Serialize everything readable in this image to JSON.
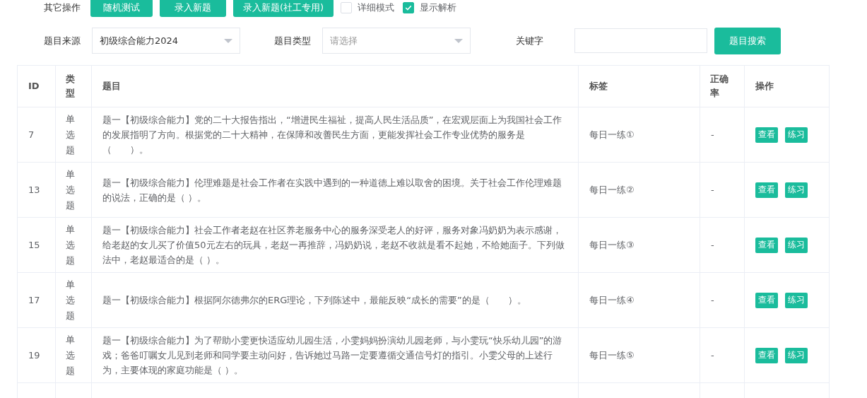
{
  "ops": {
    "label": "其它操作",
    "buttons": [
      "随机测试",
      "录入新题",
      "录入新题(社工专用)"
    ],
    "checks": [
      {
        "label": "详细模式",
        "checked": false
      },
      {
        "label": "显示解析",
        "checked": true
      }
    ]
  },
  "filters": {
    "source": {
      "label": "题目来源",
      "value": "初级综合能力2024"
    },
    "type": {
      "label": "题目类型",
      "placeholder": "请选择"
    },
    "keyword": {
      "label": "关键字"
    },
    "search_button": "题目搜索"
  },
  "table": {
    "columns": [
      "ID",
      "类型",
      "题目",
      "标签",
      "正确率",
      "操作"
    ],
    "rows": [
      {
        "id": "7",
        "type": "单选题",
        "question": "题一【初级综合能力】党的二十大报告指出，“增进民生福祉，提高人民生活品质”，在宏观层面上为我国社会工作的发展指明了方向。根据党的二十大精神，在保障和改善民生方面，更能发挥社会工作专业优势的服务是（　　）。",
        "tag": "每日一练①",
        "rate": "-",
        "actions": [
          "查看",
          "练习"
        ]
      },
      {
        "id": "13",
        "type": "单选题",
        "question": "题一【初级综合能力】伦理难题是社会工作者在实践中遇到的一种道德上难以取舍的困境。关于社会工作伦理难题的说法，正确的是（ ）。",
        "tag": "每日一练②",
        "rate": "-",
        "actions": [
          "查看",
          "练习"
        ]
      },
      {
        "id": "15",
        "type": "单选题",
        "question": "题一【初级综合能力】社会工作者老赵在社区养老服务中心的服务深受老人的好评，服务对象冯奶奶为表示感谢，给老赵的女儿买了价值50元左右的玩具，老赵一再推辞，冯奶奶说，老赵不收就是看不起她，不给她面子。下列做法中，老赵最适合的是（ ）。",
        "tag": "每日一练③",
        "rate": "-",
        "actions": [
          "查看",
          "练习"
        ]
      },
      {
        "id": "17",
        "type": "单选题",
        "question": "题一【初级综合能力】根据阿尔德弗尔的ERG理论，下列陈述中，最能反映“成长的需要”的是（　　）。",
        "tag": "每日一练④",
        "rate": "-",
        "actions": [
          "查看",
          "练习"
        ]
      },
      {
        "id": "19",
        "type": "单选题",
        "question": "题一【初级综合能力】为了帮助小雯更快适应幼儿园生活，小雯妈妈扮演幼儿园老师，与小雯玩“快乐幼儿园”的游戏；爸爸叮嘱女儿见到老师和同学要主动问好，告诉她过马路一定要遵循交通信号灯的指引。小雯父母的上述行为，主要体现的家庭功能是（ ）。",
        "tag": "每日一练⑤",
        "rate": "-",
        "actions": [
          "查看",
          "练习"
        ]
      }
    ]
  }
}
